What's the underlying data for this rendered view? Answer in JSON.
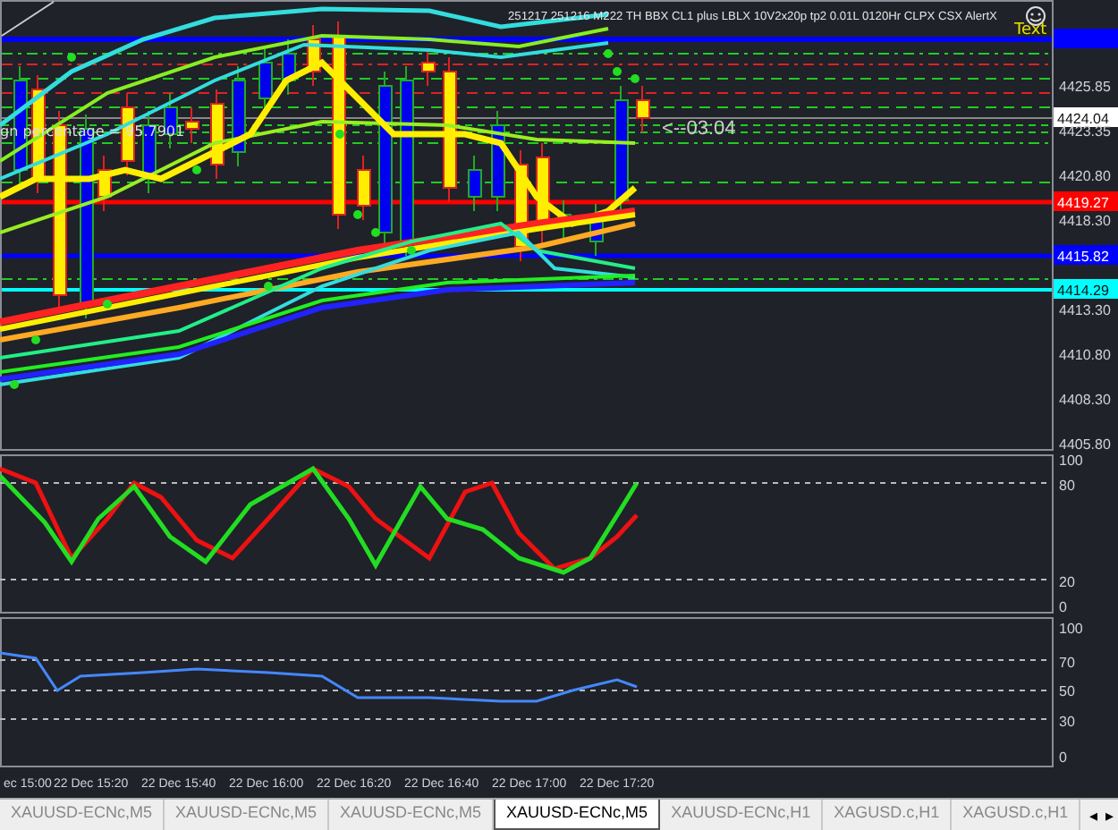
{
  "chart": {
    "header": "251217 251216 M222 TH BBX CL1 plus LBLX 10V2x20p tp2 0.01L 0120Hr CLPX CSX AlertX",
    "text_label": "Text",
    "side_note": "gn percentage = 95.7901",
    "countdown": "<--03:04"
  },
  "price_labels": [
    {
      "text": "4425.85"
    },
    {
      "text": "4424.04",
      "color": "#ffffff"
    },
    {
      "text": "4423.35"
    },
    {
      "text": "4420.80"
    },
    {
      "text": "4419.27",
      "color": "#ff0000"
    },
    {
      "text": "4418.30"
    },
    {
      "text": "4415.82",
      "color": "#0000ff"
    },
    {
      "text": "4414.29",
      "color": "#00ffff"
    },
    {
      "text": "4413.30"
    },
    {
      "text": "4410.80"
    },
    {
      "text": "4408.30"
    },
    {
      "text": "4405.80"
    }
  ],
  "oscillator_labels": [
    "100",
    "80",
    "20",
    "0"
  ],
  "lower_indicator_labels": [
    "100",
    "70",
    "50",
    "30",
    "0"
  ],
  "time_labels": [
    "ec 15:00",
    "22 Dec 15:20",
    "22 Dec 15:40",
    "22 Dec 16:00",
    "22 Dec 16:20",
    "22 Dec 16:40",
    "22 Dec 17:00",
    "22 Dec 17:20"
  ],
  "tabs": [
    {
      "label": "XAUUSD-ECNc,M5",
      "selected": false
    },
    {
      "label": "XAUUSD-ECNc,M5",
      "selected": false
    },
    {
      "label": "XAUUSD-ECNc,M5",
      "selected": false
    },
    {
      "label": "XAUUSD-ECNc,M5",
      "selected": true
    },
    {
      "label": "XAUUSD-ECNc,H1",
      "selected": false
    },
    {
      "label": "XAGUSD.c,H1",
      "selected": false
    },
    {
      "label": "XAGUSD.c,H1",
      "selected": false
    }
  ],
  "tab_scroll": [
    "◂",
    "▸"
  ]
}
